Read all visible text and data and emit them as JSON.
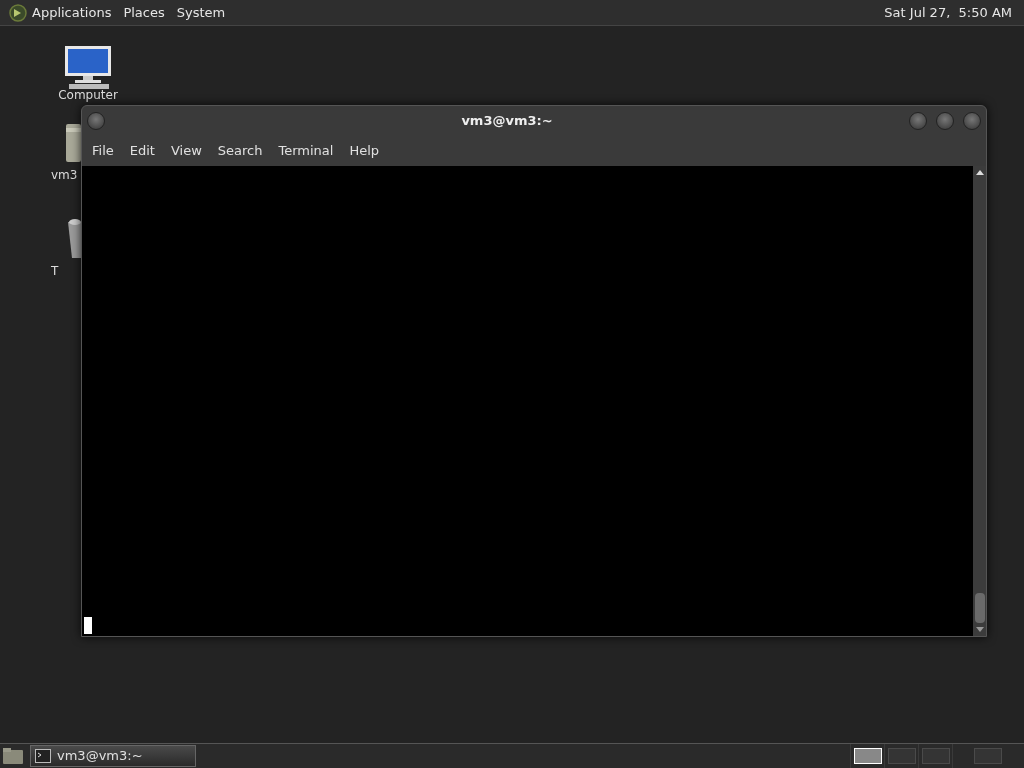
{
  "top_panel": {
    "menus": [
      "Applications",
      "Places",
      "System"
    ],
    "clock": "Sat Jul 27,  5:50 AM"
  },
  "desktop_icons": [
    {
      "kind": "computer",
      "label": "Computer"
    },
    {
      "kind": "folder",
      "label": "vm3"
    },
    {
      "kind": "trash",
      "label": "T"
    }
  ],
  "window": {
    "title": "vm3@vm3:~",
    "menu": [
      "File",
      "Edit",
      "View",
      "Search",
      "Terminal",
      "Help"
    ]
  },
  "taskbar": {
    "tasks": [
      {
        "label": "vm3@vm3:~",
        "selected": true
      }
    ],
    "workspaces": [
      {
        "selected": true
      },
      {
        "selected": false
      },
      {
        "selected": false
      },
      {
        "selected": false
      }
    ]
  }
}
